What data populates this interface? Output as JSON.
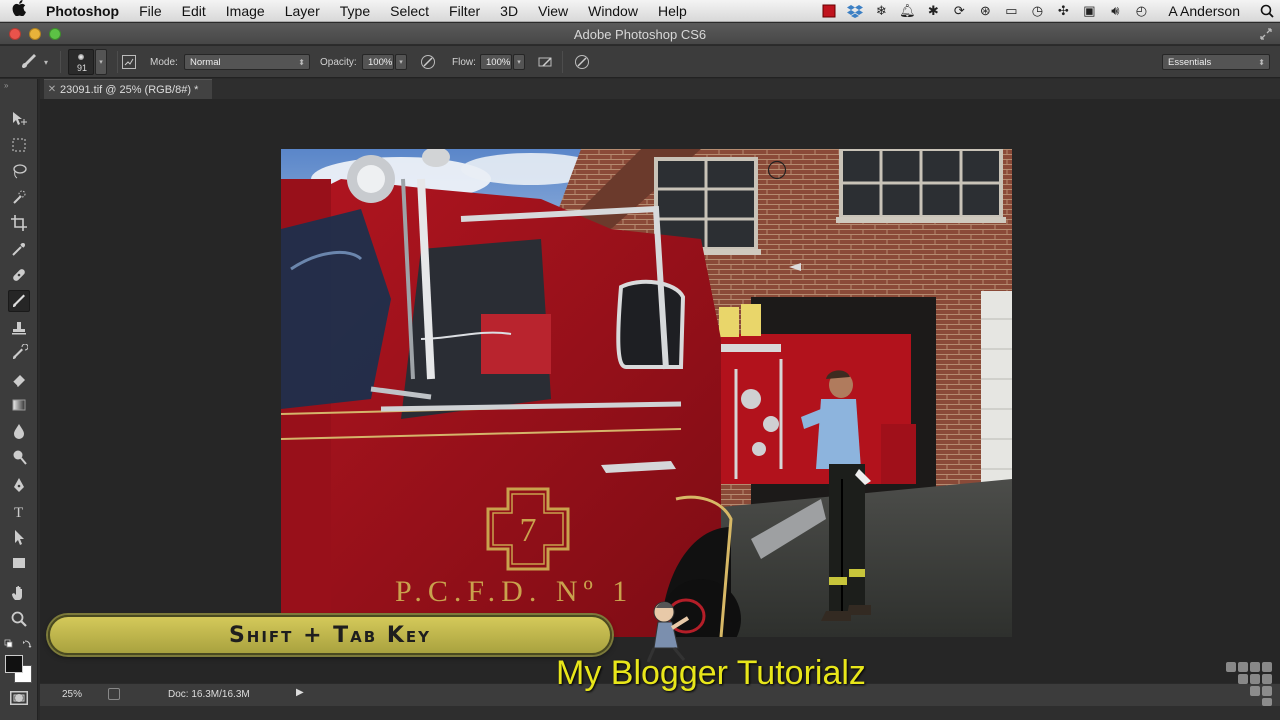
{
  "menubar": {
    "app_name": "Photoshop",
    "items": [
      "File",
      "Edit",
      "Image",
      "Layer",
      "Type",
      "Select",
      "Filter",
      "3D",
      "View",
      "Window",
      "Help"
    ],
    "user": "A Anderson",
    "status_icons": [
      "record-icon",
      "dropbox-icon",
      "snowflake-icon",
      "bell-icon",
      "paw-icon",
      "sync-icon",
      "accessibility-icon",
      "display-icon",
      "time-machine-icon",
      "bluetooth-icon",
      "screen-icon",
      "volume-icon",
      "clock-icon",
      "spotlight-icon"
    ]
  },
  "window": {
    "title": "Adobe Photoshop CS6"
  },
  "options": {
    "brush_size": "91",
    "mode_label": "Mode:",
    "mode_value": "Normal",
    "opacity_label": "Opacity:",
    "opacity_value": "100%",
    "flow_label": "Flow:",
    "flow_value": "100%",
    "workspace": "Essentials"
  },
  "document": {
    "tab_title": "23091.tif @ 25% (RGB/8#) *"
  },
  "toolbox": {
    "tools": [
      "move-tool",
      "marquee-tool",
      "lasso-tool",
      "quick-select-tool",
      "crop-tool",
      "eyedropper-tool",
      "healing-brush-tool",
      "brush-tool",
      "clone-stamp-tool",
      "history-brush-tool",
      "eraser-tool",
      "gradient-tool",
      "blur-tool",
      "dodge-tool",
      "pen-tool",
      "type-tool",
      "path-select-tool",
      "rectangle-tool",
      "hand-tool",
      "zoom-tool"
    ],
    "active_tool": "brush-tool"
  },
  "status": {
    "zoom": "25%",
    "doc_info": "Doc: 16.3M/16.3M"
  },
  "overlay": {
    "keyboard_hint": "Shift + Tab Key",
    "watermark": "My Blogger Tutorialz"
  },
  "photo": {
    "truck_number": "7",
    "truck_lettering": "P.C.F.D. Nº 1"
  },
  "colors": {
    "menubar_bg": "#e6e6e6",
    "panel_bg": "#3c3c3c",
    "canvas_bg": "#262626",
    "banner_yellow": "#cfc556",
    "watermark_yellow": "#e8e61a",
    "truck_red": "#c0141e"
  }
}
